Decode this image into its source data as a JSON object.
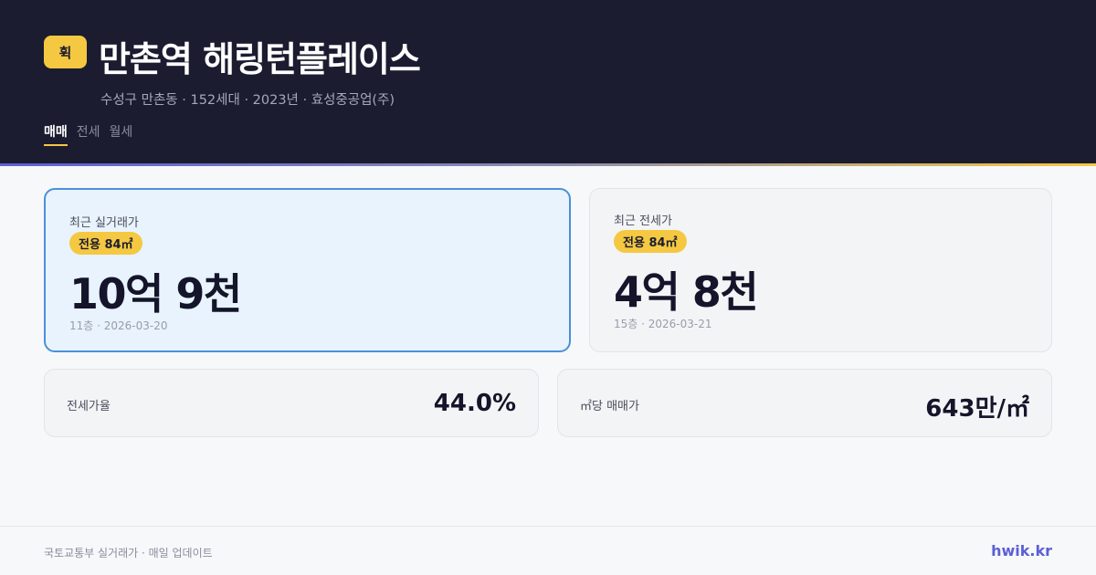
{
  "brand": {
    "logo_text": "휙",
    "site": "hwik.kr"
  },
  "header": {
    "title": "만촌역 해링턴플레이스",
    "subtitle": "수성구 만촌동 · 152세대 · 2023년 · 효성중공업(주)",
    "tabs": [
      {
        "label": "매매",
        "active": true
      },
      {
        "label": "전세",
        "active": false
      },
      {
        "label": "월세",
        "active": false
      }
    ]
  },
  "cards": {
    "sale": {
      "label": "최근 실거래가",
      "badge": "전용 84㎡",
      "price": "10억 9천",
      "meta": "11층 · 2026-03-20"
    },
    "jeonse": {
      "label": "최근 전세가",
      "badge": "전용 84㎡",
      "price": "4억 8천",
      "meta": "15층 · 2026-03-21"
    }
  },
  "stats": {
    "ratio": {
      "label": "전세가율",
      "value": "44.0%"
    },
    "ppm": {
      "label": "㎡당 매매가",
      "value": "643만/㎡"
    }
  },
  "footer": {
    "source": "국토교통부 실거래가 · 매일 업데이트"
  },
  "colors": {
    "header_bg": "#1b1c30",
    "accent_yellow": "#f5c842",
    "accent_blue": "#4a90d9",
    "brand_purple": "#5b5fd6"
  }
}
